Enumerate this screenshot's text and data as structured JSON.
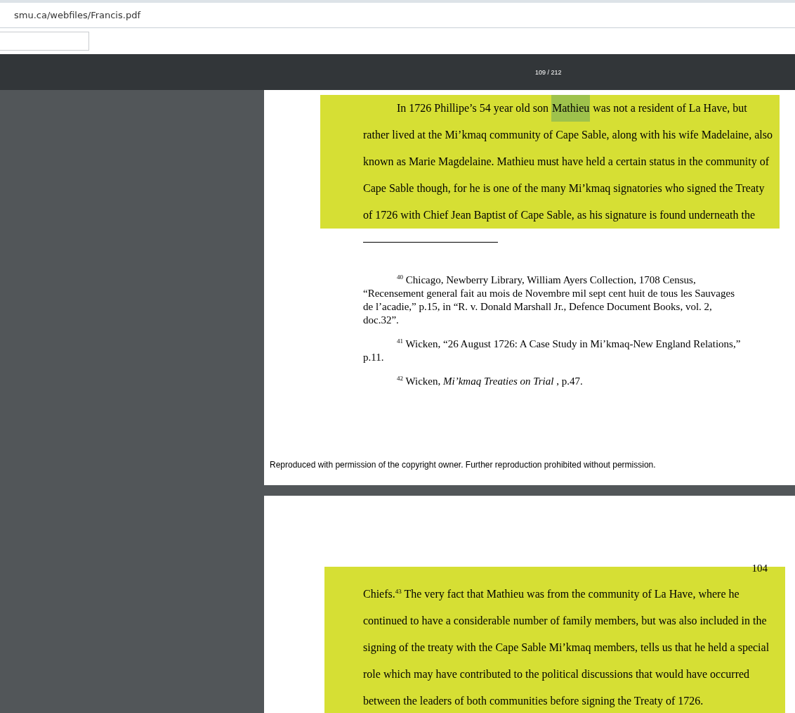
{
  "address_bar": {
    "url": "smu.ca/webfiles/Francis.pdf"
  },
  "pdf_toolbar": {
    "page_indicator": "109 / 212"
  },
  "pages": [
    {
      "highlight_lines": [
        [
          {
            "text": "In 1726 Phillipe’s 54 year old son",
            "search_match": false
          },
          {
            "text": "Mathieu",
            "search_match": true
          },
          {
            "text": "was not a resident of La Have, but",
            "search_match": false
          }
        ],
        [
          {
            "text": "rather lived at the Mi’kmaq community of Cape Sable, along with his wife Madelaine, also",
            "search_match": false
          }
        ],
        [
          {
            "text": "known as Marie Magdelaine.  Mathieu must have held a certain status in the community of",
            "search_match": false
          }
        ],
        [
          {
            "text": "Cape Sable though, for he is one of the many Mi’kmaq signatories who signed the Treaty",
            "search_match": false
          }
        ],
        [
          {
            "text": "of 1726 with Chief Jean Baptist of Cape Sable, as his signature is found underneath the",
            "search_match": false
          }
        ]
      ],
      "footnotes": [
        {
          "lines": [
            "$^{40}$ Chicago, Newberry Library, William Ayers Collection, 1708 Census,",
            "“Recensement general fait au mois de Novembre mil sept cent huit de tous les Sauvages",
            "de l’acadie,” p.15, in  “R. v. Donald Marshall Jr., Defence Document Books, vol. 2,",
            "doc.32”."
          ]
        },
        {
          "lines": [
            "$^{41}$ Wicken, “26 August 1726: A Case Study in Mi’kmaq-New England Relations,”",
            "p.11."
          ]
        },
        {
          "lines": [
            "$^{42}$ Wicken, *Mi’kmaq Treaties on Trial* , p.47."
          ]
        }
      ],
      "footer": "Reproduced with permission of the copyright owner.  Further reproduction prohibited without permission."
    },
    {
      "page_number": "104",
      "highlight_lines": [
        [
          {
            "text": "Chiefs.$^{43}$ The very fact that Mathieu was from the community of La Have, where he",
            "search_match": false
          }
        ],
        [
          {
            "text": "continued to have a considerable number of family members, but was also included in the",
            "search_match": false
          }
        ],
        [
          {
            "text": "signing of the treaty with the Cape Sable Mi’kmaq members, tells us that he held a special",
            "search_match": false
          }
        ],
        [
          {
            "text": "role which may have contributed to the political discussions that would have occurred",
            "search_match": false
          }
        ],
        [
          {
            "text": "between the leaders of both communities before signing the Treaty of 1726.",
            "search_match": false
          }
        ]
      ]
    }
  ]
}
